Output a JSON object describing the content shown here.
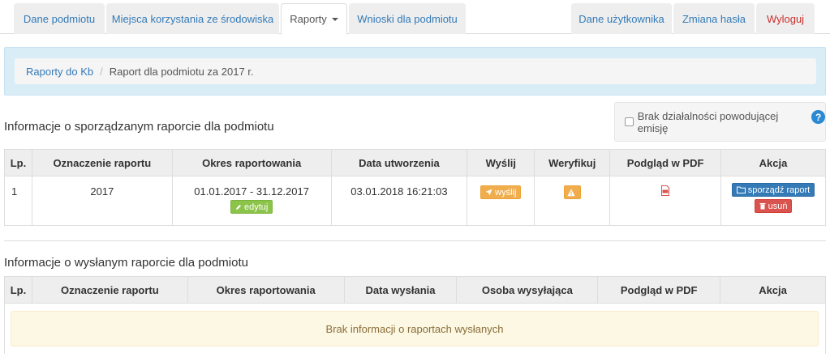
{
  "nav": {
    "tabs": [
      {
        "label": "Dane podmiotu"
      },
      {
        "label": "Miejsca korzystania ze środowiska"
      },
      {
        "label": "Raporty"
      },
      {
        "label": "Wnioski dla podmiotu"
      }
    ],
    "right_tabs": [
      {
        "label": "Dane użytkownika"
      },
      {
        "label": "Zmiana hasła"
      },
      {
        "label": "Wyloguj"
      }
    ]
  },
  "breadcrumb": {
    "link": "Raporty do Kb",
    "separator": "/",
    "current": "Raport dla podmiotu za 2017 r."
  },
  "prepared": {
    "title": "Informacje o sporządzanym raporcie dla podmiotu",
    "no_emission_label": "Brak działalności powodującej emisję",
    "help_glyph": "?",
    "columns": [
      "Lp.",
      "Oznaczenie raportu",
      "Okres raportowania",
      "Data utworzenia",
      "Wyślij",
      "Weryfikuj",
      "Podgląd w PDF",
      "Akcja"
    ],
    "row": {
      "lp": "1",
      "designation": "2017",
      "period": "01.01.2017 - 31.12.2017",
      "edit_label": "edytuj",
      "created": "03.01.2018 16:21:03",
      "send_label": "wyślij",
      "prepare_label": "sporządź raport",
      "delete_label": "usuń"
    }
  },
  "sent": {
    "title": "Informacje o wysłanym raporcie dla podmiotu",
    "columns": [
      "Lp.",
      "Oznaczenie raportu",
      "Okres raportowania",
      "Data wysłania",
      "Osoba wysyłająca",
      "Podgląd w PDF",
      "Akcja"
    ],
    "empty_message": "Brak informacji o raportach wysłanych"
  },
  "colors": {
    "link": "#337ab7",
    "logout": "#c9302c",
    "info_panel": "#d9edf7",
    "edit_button": "#8cc34a",
    "send_button": "#f0ad4e",
    "prepare_button": "#337ab7",
    "delete_button": "#d9534f",
    "warning_panel": "#fcf8e3"
  },
  "icons": {
    "edit": "pencil-icon",
    "send": "paper-plane-icon",
    "verify": "warning-icon",
    "pdf": "pdf-file-icon",
    "prepare": "folder-icon",
    "delete": "trash-icon",
    "help": "help-icon",
    "dropdown": "caret-down-icon"
  }
}
